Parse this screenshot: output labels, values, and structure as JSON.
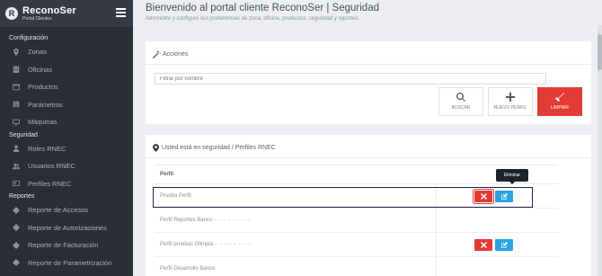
{
  "brand": {
    "logo_letter": "R",
    "title": "ReconoSer",
    "subtitle": "Portal Clientes"
  },
  "sidebar": {
    "sections": [
      {
        "title": "Configuración",
        "items": [
          {
            "label": "Zonas",
            "icon": "map-marker-icon"
          },
          {
            "label": "Oficinas",
            "icon": "building-icon"
          },
          {
            "label": "Productos",
            "icon": "box-icon"
          },
          {
            "label": "Parámetros",
            "icon": "list-icon"
          },
          {
            "label": "Máquinas",
            "icon": "monitor-icon"
          }
        ]
      },
      {
        "title": "Seguridad",
        "items": [
          {
            "label": "Roles RNEC",
            "icon": "user-icon"
          },
          {
            "label": "Usuarios RNEC",
            "icon": "users-icon"
          },
          {
            "label": "Perfiles RNEC",
            "icon": "id-card-icon"
          }
        ]
      },
      {
        "title": "Reportes",
        "items": [
          {
            "label": "Reporte de Accesos",
            "icon": "chevron-icon"
          },
          {
            "label": "Reporte de Autorizaciones",
            "icon": "chevron-icon"
          },
          {
            "label": "Reporte de Facturación",
            "icon": "chevron-icon"
          },
          {
            "label": "Reporte de Parametrización",
            "icon": "chevron-icon"
          }
        ]
      }
    ]
  },
  "header": {
    "title": "Bienvenido al portal cliente ReconoSer | Seguridad",
    "subtitle": "Administre y configure sus preferencias de zona, oficina, productos, seguridad y reportes."
  },
  "actions": {
    "title": "Acciones",
    "search_placeholder": "Filtrar por nombre",
    "buttons": {
      "search": "BUSCAR",
      "new": "NUEVO PERFIL",
      "clear": "LIMPIAR"
    }
  },
  "profiles": {
    "breadcrumb": "Usted está en seguridad / Perfiles RNEC",
    "column_header": "Perfil",
    "tooltip": "Eliminar",
    "rows": [
      {
        "name": "Prueba Perfil"
      },
      {
        "name": "Perfil Reportes Banco"
      },
      {
        "name": "Perfil pruebas Olimpia"
      },
      {
        "name": "Perfil Desarrollo Banco"
      }
    ]
  },
  "colors": {
    "sidebar": "#2a2e36",
    "danger": "#e23b36",
    "primary": "#2ba3e3",
    "highlight": "#1c2352"
  }
}
